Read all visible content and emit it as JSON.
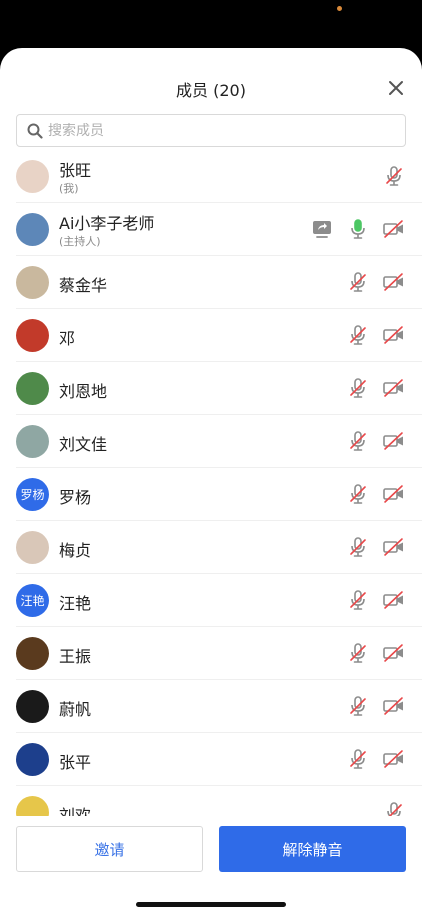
{
  "header": {
    "title": "成员 (20)"
  },
  "search": {
    "placeholder": "搜索成员"
  },
  "members": [
    {
      "name": "张旺",
      "subtitle": "(我)",
      "avatar_text": "",
      "avatar_color": "#e8d3c6",
      "share": false,
      "mic": "muted",
      "cam": "none"
    },
    {
      "name": "Ai小李子老师",
      "subtitle": "(主持人)",
      "avatar_text": "",
      "avatar_color": "#5d87b8",
      "share": true,
      "mic": "active",
      "cam": "off"
    },
    {
      "name": "蔡金华",
      "subtitle": "",
      "avatar_text": "",
      "avatar_color": "#c9b89e",
      "share": false,
      "mic": "muted",
      "cam": "off"
    },
    {
      "name": "邓",
      "subtitle": "",
      "avatar_text": "",
      "avatar_color": "#c23a2a",
      "share": false,
      "mic": "muted",
      "cam": "off"
    },
    {
      "name": "刘恩地",
      "subtitle": "",
      "avatar_text": "",
      "avatar_color": "#4f8a4a",
      "share": false,
      "mic": "muted",
      "cam": "off"
    },
    {
      "name": "刘文佳",
      "subtitle": "",
      "avatar_text": "",
      "avatar_color": "#8fa7a3",
      "share": false,
      "mic": "muted",
      "cam": "off"
    },
    {
      "name": "罗杨",
      "subtitle": "",
      "avatar_text": "罗杨",
      "avatar_color": "#2f6be8",
      "share": false,
      "mic": "muted",
      "cam": "off"
    },
    {
      "name": "梅贞",
      "subtitle": "",
      "avatar_text": "",
      "avatar_color": "#d9c7b8",
      "share": false,
      "mic": "muted",
      "cam": "off"
    },
    {
      "name": "汪艳",
      "subtitle": "",
      "avatar_text": "汪艳",
      "avatar_color": "#2f6be8",
      "share": false,
      "mic": "muted",
      "cam": "off"
    },
    {
      "name": "王振",
      "subtitle": "",
      "avatar_text": "",
      "avatar_color": "#5a3a1e",
      "share": false,
      "mic": "muted",
      "cam": "off"
    },
    {
      "name": "蔚帆",
      "subtitle": "",
      "avatar_text": "",
      "avatar_color": "#1a1a1a",
      "share": false,
      "mic": "muted",
      "cam": "off"
    },
    {
      "name": "张平",
      "subtitle": "",
      "avatar_text": "",
      "avatar_color": "#1d3f8c",
      "share": false,
      "mic": "muted",
      "cam": "off"
    },
    {
      "name": "刘欢",
      "subtitle": "",
      "avatar_text": "",
      "avatar_color": "#e6c64a",
      "share": false,
      "mic": "muted",
      "cam": "none"
    }
  ],
  "footer": {
    "invite_label": "邀请",
    "unmute_label": "解除静音"
  },
  "colors": {
    "accent": "#2f6be8",
    "mic_active": "#4cc764",
    "muted_red": "#e8484a",
    "icon_grey": "#8c8c8c"
  }
}
